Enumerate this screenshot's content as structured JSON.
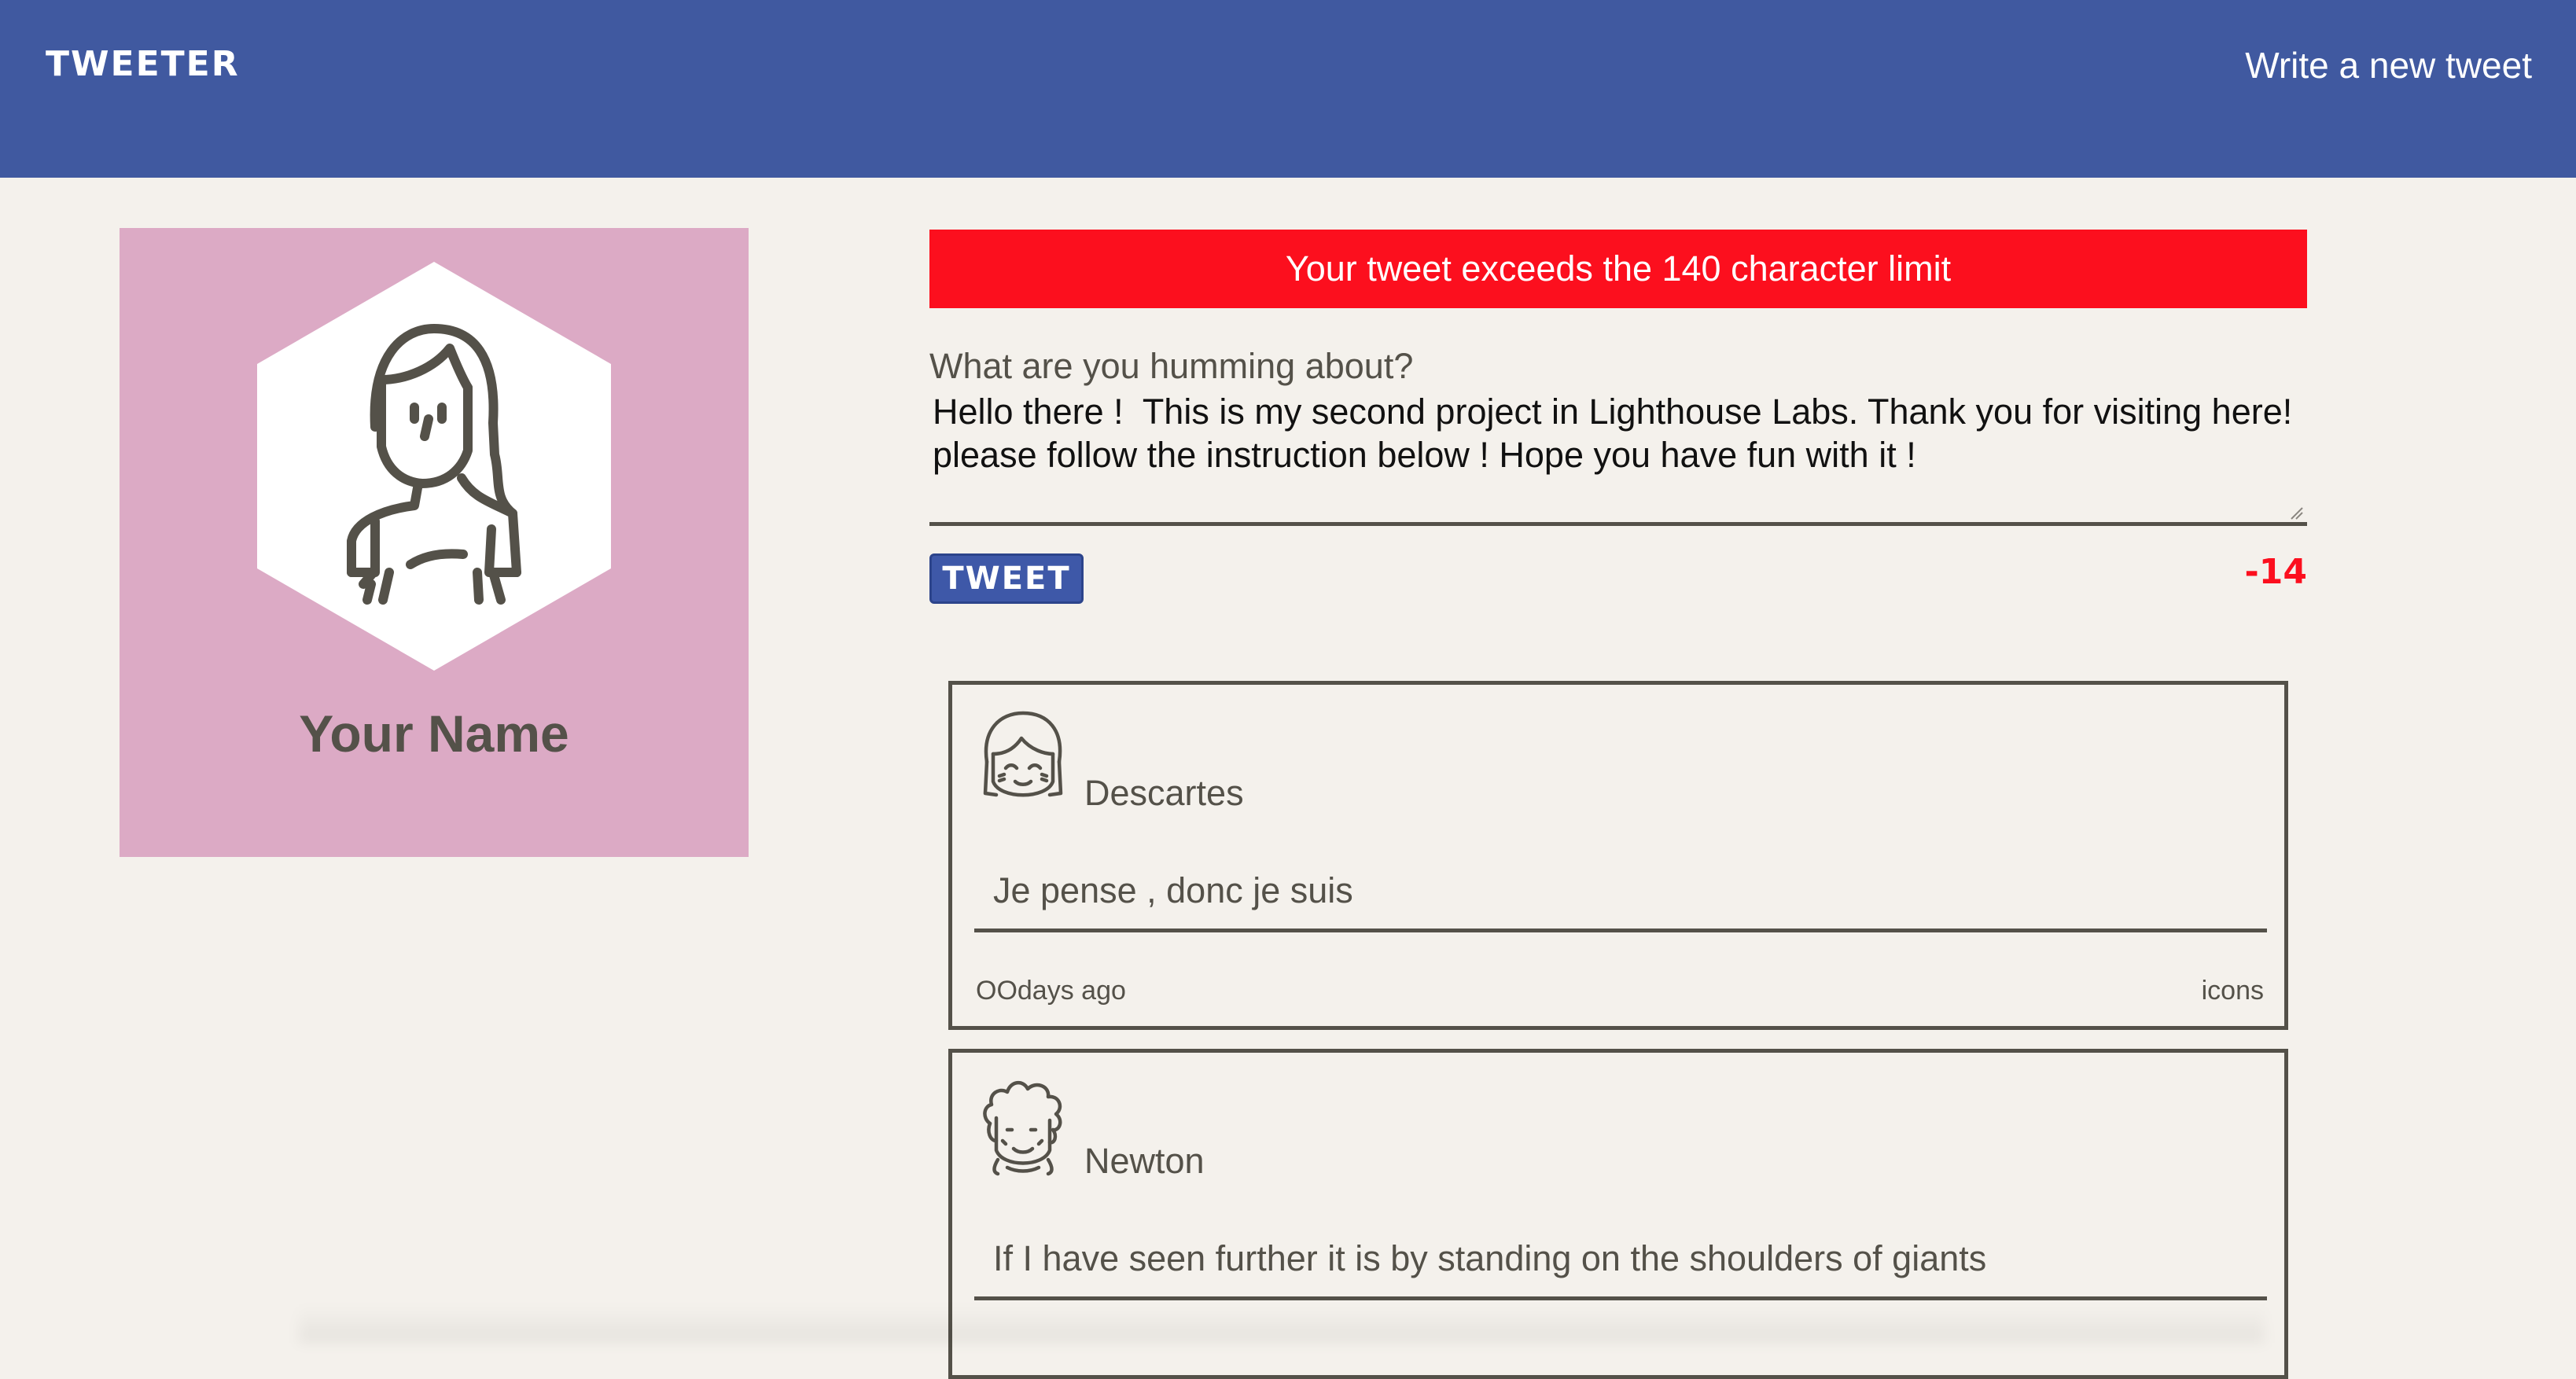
{
  "nav": {
    "brand": "TWEETER",
    "compose_link": "Write a new tweet"
  },
  "profile": {
    "avatar_icon": "girl-avatar-icon",
    "name": "Your Name",
    "background_color": "#dcaac5"
  },
  "composer": {
    "error": "Your tweet exceeds the 140 character limit",
    "label": "What are you humming about?",
    "text": "Hello there !  This is my second project in Lighthouse Labs. Thank you for visiting here!\nplease follow the instruction below ! Hope you have fun with it !",
    "button_label": "TWEET",
    "counter": "-14"
  },
  "tweets": [
    {
      "avatar_icon": "smiling-face-avatar-icon",
      "author": "Descartes",
      "body": "Je pense , donc je suis",
      "time": "OOdays ago",
      "icons_label": "icons"
    },
    {
      "avatar_icon": "curly-hair-avatar-icon",
      "author": "Newton",
      "body": "If I have seen further it is by standing on the shoulders of giants"
    }
  ],
  "colors": {
    "nav": "#4059a0",
    "background": "#f4f1ec",
    "error": "#fc0f1e",
    "text": "#545149",
    "button": "#3e58a8"
  }
}
